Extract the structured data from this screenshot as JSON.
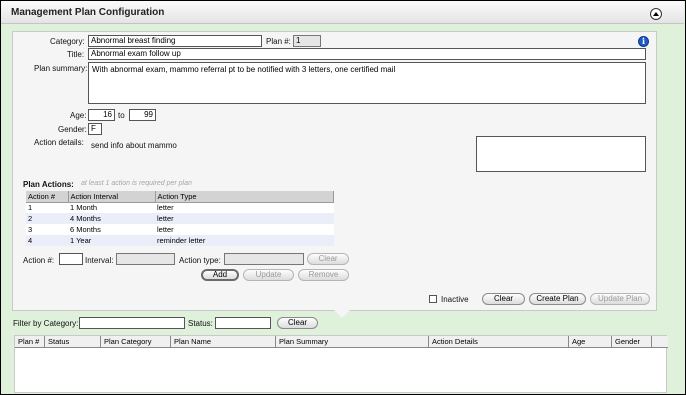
{
  "header": {
    "title": "Management Plan Configuration"
  },
  "form": {
    "category_label": "Category:",
    "category_value": "Abnormal breast finding",
    "plan_num_label": "Plan #:",
    "plan_num_value": "1",
    "title_label": "Title:",
    "title_value": "Abnormal exam follow up",
    "summary_label": "Plan summary:",
    "summary_value": "With abnormal exam, mammo referral pt to be notified with 3 letters, one certified mail",
    "age_label": "Age:",
    "age_from": "16",
    "age_to_label": "to",
    "age_to": "99",
    "gender_label": "Gender:",
    "gender_value": "F",
    "action_details_label": "Action details:",
    "action_details_value": "send info about mammo"
  },
  "plan_actions": {
    "title": "Plan Actions:",
    "hint": "at least 1 action is required per plan",
    "columns": [
      "Action #",
      "Action Interval",
      "Action Type"
    ],
    "rows": [
      {
        "num": "1",
        "interval": "1 Month",
        "type": "letter"
      },
      {
        "num": "2",
        "interval": "4 Months",
        "type": "letter"
      },
      {
        "num": "3",
        "interval": "6 Months",
        "type": "letter"
      },
      {
        "num": "4",
        "interval": "1 Year",
        "type": "reminder letter"
      }
    ],
    "action_num_label": "Action #:",
    "interval_label": "Interval:",
    "action_type_label": "Action type:",
    "clear_label": "Clear",
    "add_label": "Add",
    "update_label": "Update",
    "remove_label": "Remove"
  },
  "footer_actions": {
    "inactive_label": "Inactive",
    "clear_label": "Clear",
    "create_label": "Create Plan",
    "update_label": "Update Plan"
  },
  "filter": {
    "category_label": "Filter by Category:",
    "category_value": "",
    "status_label": "Status:",
    "status_value": "",
    "clear_label": "Clear"
  },
  "grid": {
    "columns": [
      "Plan #",
      "Status",
      "Plan Category",
      "Plan Name",
      "Plan Summary",
      "Action Details",
      "Age",
      "Gender"
    ]
  },
  "colors": {
    "panel_bg": "#f5f5f5",
    "frame_bg": "#dff0db",
    "alt_row": "#e9eef9",
    "info_icon": "#1a5dc6"
  }
}
